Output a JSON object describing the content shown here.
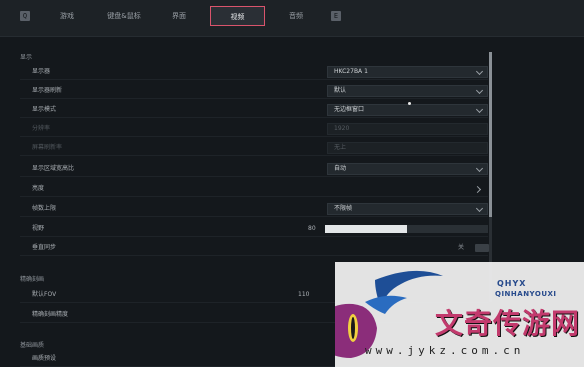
{
  "keys": {
    "left": "Q",
    "right": "E"
  },
  "tabs": [
    {
      "label": "游戏"
    },
    {
      "label": "键盘&鼠标"
    },
    {
      "label": "界面"
    },
    {
      "label": "视频"
    },
    {
      "label": "音频"
    }
  ],
  "active_tab": "视频",
  "sections": {
    "display": "显示",
    "performance": "精确刻画",
    "basic": "基础画质"
  },
  "rows": {
    "monitor": {
      "label": "显示器",
      "value": "HKC27BA 1"
    },
    "res_scale": {
      "label": "显示器刷新",
      "value": "默认"
    },
    "display_mode": {
      "label": "显示模式",
      "value": "无边框窗口"
    },
    "resolution": {
      "label": "分辨率",
      "value": "1920"
    },
    "refresh_rate": {
      "label": "屏幕刷新率",
      "value": "无上"
    },
    "aspect": {
      "label": "显示区域宽高比",
      "value": "自动"
    },
    "brightness": {
      "label": "亮度"
    },
    "fps_limit": {
      "label": "帧数上限",
      "value": "不限帧"
    },
    "fov": {
      "label": "视野",
      "value": "80",
      "fraction": 0.5
    },
    "vsync": {
      "label": "垂直同步",
      "state": "关"
    },
    "default_fov": {
      "label": "默认FOV",
      "value": "110"
    },
    "hd_texture": {
      "label": "精确刻画精度"
    },
    "quality_preset": {
      "label": "画质预设"
    }
  },
  "watermark": {
    "hyx": "QHYX",
    "en": "QINHANYOUXI",
    "cn": "文奇传游网",
    "url": "www.jykz.com.cn"
  },
  "scrollbar": {
    "position": 0.0
  }
}
